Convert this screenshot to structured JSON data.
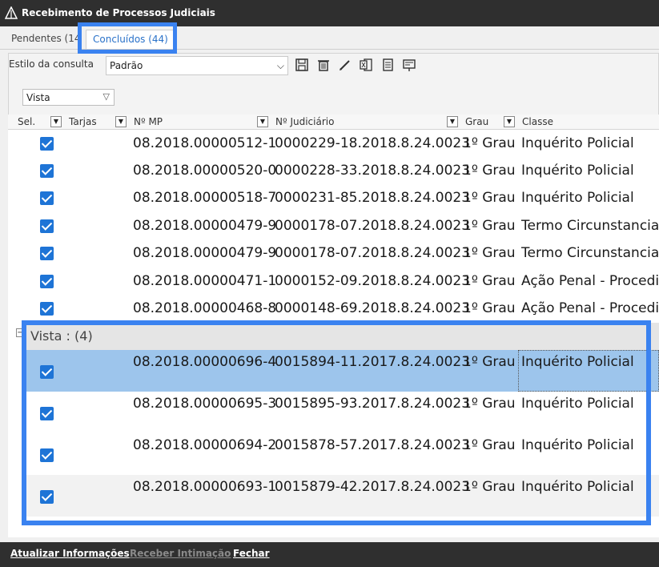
{
  "window": {
    "title": "Recebimento de Processos Judiciais",
    "logo_icon": "app-logo-icon"
  },
  "tabs": [
    {
      "label": "Pendentes (14"
    },
    {
      "label": "Concluídos (44)"
    }
  ],
  "toolbar": {
    "estilo_label": "Estilo da consulta",
    "estilo_value": "Padrão",
    "icons": [
      "save-icon",
      "delete-icon",
      "edit-icon",
      "export-excel-icon",
      "document-icon",
      "print-preview-icon"
    ]
  },
  "vista_filter": {
    "value": "Vista"
  },
  "columns": [
    {
      "label": "Sel."
    },
    {
      "label": "Tarjas"
    },
    {
      "label": "Nº MP"
    },
    {
      "label": "Nº Judiciário"
    },
    {
      "label": "Grau"
    },
    {
      "label": "Classe"
    }
  ],
  "rows": [
    {
      "mp": "08.2018.00000512-1",
      "judiciario": "0000229-18.2018.8.24.0023",
      "grau": "1º Grau",
      "classe": "Inquérito Policial"
    },
    {
      "mp": "08.2018.00000520-0",
      "judiciario": "0000228-33.2018.8.24.0023",
      "grau": "1º Grau",
      "classe": "Inquérito Policial"
    },
    {
      "mp": "08.2018.00000518-7",
      "judiciario": "0000231-85.2018.8.24.0023",
      "grau": "1º Grau",
      "classe": "Inquérito Policial"
    },
    {
      "mp": "08.2018.00000479-9",
      "judiciario": "0000178-07.2018.8.24.0023",
      "grau": "1º Grau",
      "classe": "Termo Circunstanciad"
    },
    {
      "mp": "08.2018.00000479-9",
      "judiciario": "0000178-07.2018.8.24.0023",
      "grau": "1º Grau",
      "classe": "Termo Circunstanciad"
    },
    {
      "mp": "08.2018.00000471-1",
      "judiciario": "0000152-09.2018.8.24.0023",
      "grau": "1º Grau",
      "classe": "Ação Penal - Procedin"
    },
    {
      "mp": "08.2018.00000468-8",
      "judiciario": "0000148-69.2018.8.24.0023",
      "grau": "1º Grau",
      "classe": "Ação Penal - Procedin"
    }
  ],
  "group": {
    "label": "Vista :  (4)",
    "rows": [
      {
        "mp": "08.2018.00000696-4",
        "judiciario": "0015894-11.2017.8.24.0023",
        "grau": "1º Grau",
        "classe": "Inquérito Policial"
      },
      {
        "mp": "08.2018.00000695-3",
        "judiciario": "0015895-93.2017.8.24.0023",
        "grau": "1º Grau",
        "classe": "Inquérito Policial"
      },
      {
        "mp": "08.2018.00000694-2",
        "judiciario": "0015878-57.2017.8.24.0023",
        "grau": "1º Grau",
        "classe": "Inquérito Policial"
      },
      {
        "mp": "08.2018.00000693-1",
        "judiciario": "0015879-42.2017.8.24.0023",
        "grau": "1º Grau",
        "classe": "Inquérito Policial"
      }
    ]
  },
  "footer": {
    "atualizar": "Atualizar Informações",
    "receber": "Receber Intimação",
    "fechar": "Fechar"
  },
  "colors": {
    "accent": "#1e74d6",
    "highlight": "#3a82f0",
    "selected_row": "#9dc5ec"
  }
}
